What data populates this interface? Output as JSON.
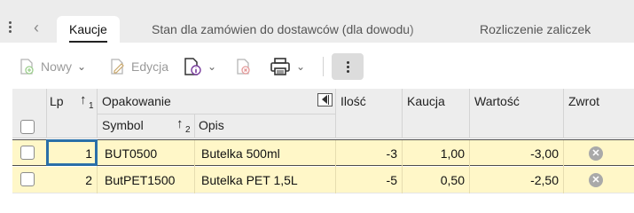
{
  "tabs": [
    {
      "label": "Kaucje",
      "active": true
    },
    {
      "label": "Stan dla zamówien do dostawców (dla dowodu)",
      "active": false
    },
    {
      "label": "Rozliczenie zaliczek",
      "active": false
    }
  ],
  "toolbar": {
    "new_label": "Nowy",
    "edit_label": "Edycja"
  },
  "grid": {
    "columns": {
      "lp": "Lp",
      "lp_sort_index": "1",
      "opakowanie": "Opakowanie",
      "symbol": "Symbol",
      "symbol_sort_index": "2",
      "opis": "Opis",
      "ilosc": "Ilość",
      "kaucja": "Kaucja",
      "wartosc": "Wartość",
      "zwrot": "Zwrot"
    },
    "rows": [
      {
        "lp": "1",
        "symbol": "BUT0500",
        "opis": "Butelka 500ml",
        "ilosc": "-3",
        "kaucja": "1,00",
        "wartosc": "-3,00"
      },
      {
        "lp": "2",
        "symbol": "ButPET1500",
        "opis": "Butelka PET 1,5L",
        "ilosc": "-5",
        "kaucja": "0,50",
        "wartosc": "-2,50"
      }
    ]
  }
}
